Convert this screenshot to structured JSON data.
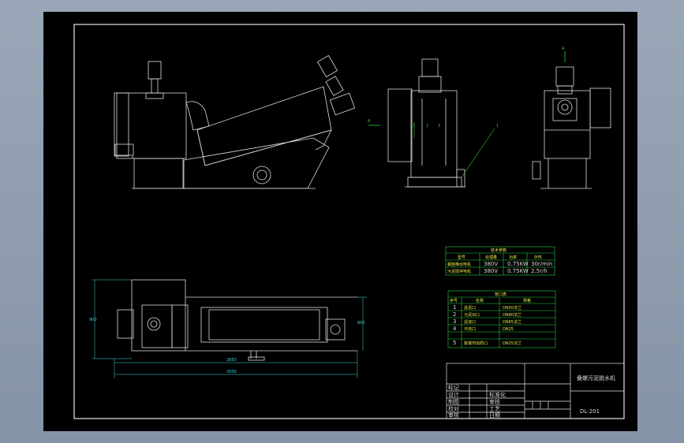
{
  "title_block": {
    "drawing_title": "叠螺污泥脱水机",
    "drawing_number": "DL-201",
    "rows": [
      {
        "label": "标记",
        "value": ""
      },
      {
        "label": "设计",
        "value": "标准化"
      },
      {
        "label": "制图",
        "value": "审核"
      },
      {
        "label": "校对",
        "value": "工艺"
      },
      {
        "label": "审核",
        "value": "日期"
      }
    ]
  },
  "specs_table": {
    "title": "技术参数",
    "headers": [
      "型号",
      "处理量",
      "功率",
      "外形"
    ],
    "rows": [
      [
        "螺旋推动电机",
        "380V",
        "0.75KW",
        "30r/min"
      ],
      [
        "污泥搅拌电机",
        "380V",
        "0.75KW",
        "2.5r/h"
      ]
    ]
  },
  "parts_table": {
    "title": "管口表",
    "headers": [
      "序号",
      "名称",
      "规格"
    ],
    "rows": [
      [
        "1",
        "进泥口",
        "DN50法兰"
      ],
      [
        "2",
        "污泥出口",
        "DN80法兰"
      ],
      [
        "3",
        "滤液口",
        "DN65法兰"
      ],
      [
        "4",
        "冲洗口",
        "DN25"
      ],
      [
        "5",
        "絮凝剂加药口",
        "DN25法兰"
      ]
    ]
  },
  "annotations": {
    "section_a_left": "A",
    "section_a_top": "A",
    "callout_part": "1",
    "labels_mid": [
      "1",
      "2",
      "3"
    ],
    "dim_total": "3500",
    "dim_body": "2850",
    "dim_height": "900",
    "dim_width_right": "600"
  },
  "colors": {
    "background": "#000000",
    "frame_line": "#e6e6e6",
    "table_line": "#2bd13c",
    "dimension_line": "#3fd6d6",
    "callout": "#2bd13c"
  }
}
